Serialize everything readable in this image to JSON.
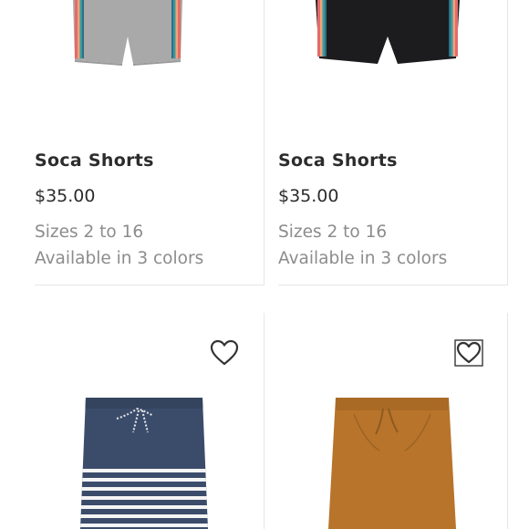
{
  "products": [
    {
      "title": "Soca Shorts",
      "price": "$35.00",
      "sizes": "Sizes 2 to 16",
      "colors": "Available in 3 colors",
      "image": "gray-striped-side-shorts"
    },
    {
      "title": "Soca Shorts",
      "price": "$35.00",
      "sizes": "Sizes 2 to 16",
      "colors": "Available in 3 colors",
      "image": "black-striped-side-shorts"
    },
    {
      "image": "navy-white-striped-shorts",
      "favorite_icon": "heart-icon"
    },
    {
      "image": "tan-drawstring-shorts",
      "favorite_icon": "heart-icon"
    }
  ],
  "colors": {
    "text": "#2c2c2c",
    "muted": "#8c8c8c",
    "gray_fabric": "#a7a7a7",
    "black_fabric": "#1c1c1e",
    "navy_fabric": "#3b4c6b",
    "tan_fabric": "#b8742b"
  }
}
